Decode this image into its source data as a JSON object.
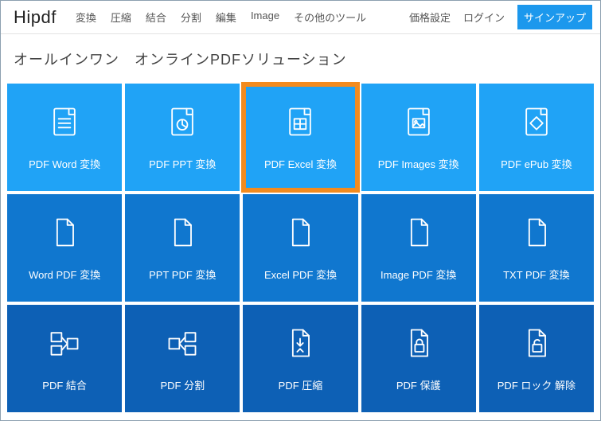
{
  "logo": "Hipdf",
  "nav": [
    "変換",
    "圧縮",
    "結合",
    "分割",
    "編集",
    "Image",
    "その他のツール"
  ],
  "rightnav": {
    "pricing": "価格設定",
    "login": "ログイン",
    "signup": "サインアップ"
  },
  "tagline": "オールインワン　オンラインPDFソリューション",
  "tiles": [
    [
      {
        "label": "PDF Word 変換",
        "icon": "doc-lines",
        "name": "tile-pdf-to-word"
      },
      {
        "label": "PDF PPT 変換",
        "icon": "doc-pie",
        "name": "tile-pdf-to-ppt"
      },
      {
        "label": "PDF Excel 変換",
        "icon": "doc-grid",
        "name": "tile-pdf-to-excel",
        "highlight": true
      },
      {
        "label": "PDF Images 変換",
        "icon": "doc-image",
        "name": "tile-pdf-to-images"
      },
      {
        "label": "PDF ePub 変換",
        "icon": "doc-epub",
        "name": "tile-pdf-to-epub"
      }
    ],
    [
      {
        "label": "Word PDF 変換",
        "icon": "page-fold",
        "name": "tile-word-to-pdf"
      },
      {
        "label": "PPT PDF 変換",
        "icon": "page-fold",
        "name": "tile-ppt-to-pdf"
      },
      {
        "label": "Excel PDF 変換",
        "icon": "page-fold",
        "name": "tile-excel-to-pdf"
      },
      {
        "label": "Image PDF 変換",
        "icon": "page-fold",
        "name": "tile-image-to-pdf"
      },
      {
        "label": "TXT PDF 変換",
        "icon": "page-fold",
        "name": "tile-txt-to-pdf"
      }
    ],
    [
      {
        "label": "PDF 結合",
        "icon": "merge",
        "name": "tile-pdf-merge"
      },
      {
        "label": "PDF 分割",
        "icon": "split",
        "name": "tile-pdf-split"
      },
      {
        "label": "PDF 圧縮",
        "icon": "compress",
        "name": "tile-pdf-compress"
      },
      {
        "label": "PDF 保護",
        "icon": "lock",
        "name": "tile-pdf-protect"
      },
      {
        "label": "PDF ロック 解除",
        "icon": "unlock",
        "name": "tile-pdf-unlock"
      }
    ]
  ]
}
